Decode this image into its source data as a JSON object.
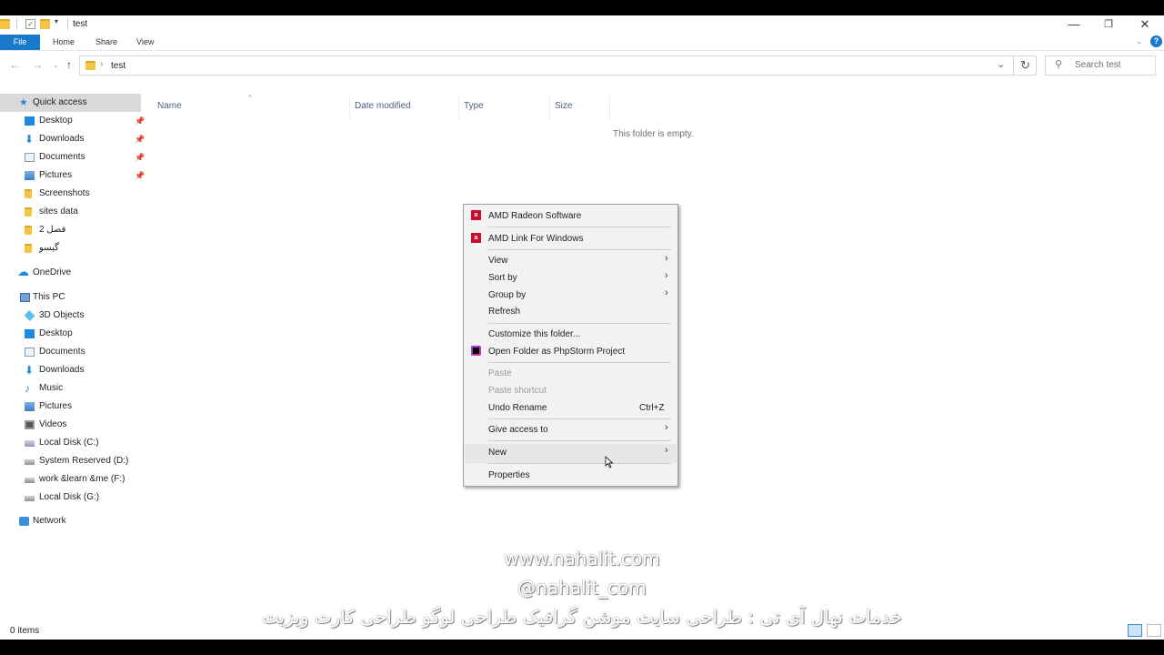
{
  "window": {
    "title": "test"
  },
  "ribbon": {
    "tabs": [
      "File",
      "Home",
      "Share",
      "View"
    ],
    "help_label": "?"
  },
  "address": {
    "path": "test",
    "search_placeholder": "Search test"
  },
  "sidebar": {
    "quick_access": "Quick access",
    "quick_items": [
      {
        "label": "Desktop"
      },
      {
        "label": "Downloads"
      },
      {
        "label": "Documents"
      },
      {
        "label": "Pictures"
      },
      {
        "label": "Screenshots"
      },
      {
        "label": "sites data"
      },
      {
        "label": "فصل 2"
      },
      {
        "label": "گیسو"
      }
    ],
    "onedrive": "OneDrive",
    "this_pc": "This PC",
    "pc_items": [
      {
        "label": "3D Objects"
      },
      {
        "label": "Desktop"
      },
      {
        "label": "Documents"
      },
      {
        "label": "Downloads"
      },
      {
        "label": "Music"
      },
      {
        "label": "Pictures"
      },
      {
        "label": "Videos"
      },
      {
        "label": "Local Disk (C:)"
      },
      {
        "label": "System Reserved (D:)"
      },
      {
        "label": "work &learn &me (F:)"
      },
      {
        "label": "Local Disk (G:)"
      }
    ],
    "network": "Network"
  },
  "columns": [
    "Name",
    "Date modified",
    "Type",
    "Size"
  ],
  "empty_message": "This folder is empty.",
  "context_menu": {
    "amd_radeon": "AMD Radeon Software",
    "amd_link": "AMD Link For Windows",
    "view": "View",
    "sort_by": "Sort by",
    "group_by": "Group by",
    "refresh": "Refresh",
    "customize": "Customize this folder...",
    "phpstorm": "Open Folder as PhpStorm Project",
    "paste": "Paste",
    "paste_shortcut": "Paste shortcut",
    "undo_rename": "Undo Rename",
    "undo_shortcut": "Ctrl+Z",
    "give_access": "Give access to",
    "new": "New",
    "properties": "Properties"
  },
  "watermark": {
    "line1": "www.nahalit.com",
    "line2": "@nahalit_com",
    "line3": "خدمات نهال آی تی : طراحی سایت موشن گرافیک طراحی لوگو طراحی کارت ویزیت"
  },
  "status": {
    "items": "0 items"
  },
  "colors": {
    "accent": "#1979ca",
    "selection": "#d9d9d9",
    "amd": "#c8102e"
  }
}
